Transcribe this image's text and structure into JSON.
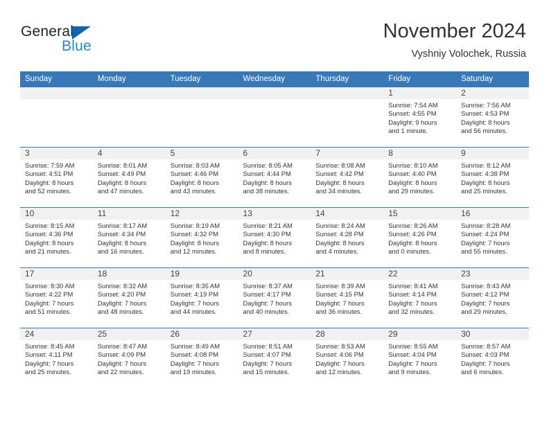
{
  "brand": {
    "name_part1": "General",
    "name_part2": "Blue",
    "accent_color": "#1f86d6",
    "triangle_color": "#1066ad"
  },
  "header": {
    "title": "November 2024",
    "subtitle": "Vyshniy Volochek, Russia"
  },
  "calendar": {
    "header_bg": "#3878b9",
    "daynum_bg": "#f1f1f1",
    "weekdays": [
      "Sunday",
      "Monday",
      "Tuesday",
      "Wednesday",
      "Thursday",
      "Friday",
      "Saturday"
    ],
    "weeks": [
      [
        {
          "day": "",
          "sunrise": "",
          "sunset": "",
          "daylight_line1": "",
          "daylight_line2": ""
        },
        {
          "day": "",
          "sunrise": "",
          "sunset": "",
          "daylight_line1": "",
          "daylight_line2": ""
        },
        {
          "day": "",
          "sunrise": "",
          "sunset": "",
          "daylight_line1": "",
          "daylight_line2": ""
        },
        {
          "day": "",
          "sunrise": "",
          "sunset": "",
          "daylight_line1": "",
          "daylight_line2": ""
        },
        {
          "day": "",
          "sunrise": "",
          "sunset": "",
          "daylight_line1": "",
          "daylight_line2": ""
        },
        {
          "day": "1",
          "sunrise": "Sunrise: 7:54 AM",
          "sunset": "Sunset: 4:55 PM",
          "daylight_line1": "Daylight: 9 hours",
          "daylight_line2": "and 1 minute."
        },
        {
          "day": "2",
          "sunrise": "Sunrise: 7:56 AM",
          "sunset": "Sunset: 4:53 PM",
          "daylight_line1": "Daylight: 8 hours",
          "daylight_line2": "and 56 minutes."
        }
      ],
      [
        {
          "day": "3",
          "sunrise": "Sunrise: 7:59 AM",
          "sunset": "Sunset: 4:51 PM",
          "daylight_line1": "Daylight: 8 hours",
          "daylight_line2": "and 52 minutes."
        },
        {
          "day": "4",
          "sunrise": "Sunrise: 8:01 AM",
          "sunset": "Sunset: 4:49 PM",
          "daylight_line1": "Daylight: 8 hours",
          "daylight_line2": "and 47 minutes."
        },
        {
          "day": "5",
          "sunrise": "Sunrise: 8:03 AM",
          "sunset": "Sunset: 4:46 PM",
          "daylight_line1": "Daylight: 8 hours",
          "daylight_line2": "and 43 minutes."
        },
        {
          "day": "6",
          "sunrise": "Sunrise: 8:05 AM",
          "sunset": "Sunset: 4:44 PM",
          "daylight_line1": "Daylight: 8 hours",
          "daylight_line2": "and 38 minutes."
        },
        {
          "day": "7",
          "sunrise": "Sunrise: 8:08 AM",
          "sunset": "Sunset: 4:42 PM",
          "daylight_line1": "Daylight: 8 hours",
          "daylight_line2": "and 34 minutes."
        },
        {
          "day": "8",
          "sunrise": "Sunrise: 8:10 AM",
          "sunset": "Sunset: 4:40 PM",
          "daylight_line1": "Daylight: 8 hours",
          "daylight_line2": "and 29 minutes."
        },
        {
          "day": "9",
          "sunrise": "Sunrise: 8:12 AM",
          "sunset": "Sunset: 4:38 PM",
          "daylight_line1": "Daylight: 8 hours",
          "daylight_line2": "and 25 minutes."
        }
      ],
      [
        {
          "day": "10",
          "sunrise": "Sunrise: 8:15 AM",
          "sunset": "Sunset: 4:36 PM",
          "daylight_line1": "Daylight: 8 hours",
          "daylight_line2": "and 21 minutes."
        },
        {
          "day": "11",
          "sunrise": "Sunrise: 8:17 AM",
          "sunset": "Sunset: 4:34 PM",
          "daylight_line1": "Daylight: 8 hours",
          "daylight_line2": "and 16 minutes."
        },
        {
          "day": "12",
          "sunrise": "Sunrise: 8:19 AM",
          "sunset": "Sunset: 4:32 PM",
          "daylight_line1": "Daylight: 8 hours",
          "daylight_line2": "and 12 minutes."
        },
        {
          "day": "13",
          "sunrise": "Sunrise: 8:21 AM",
          "sunset": "Sunset: 4:30 PM",
          "daylight_line1": "Daylight: 8 hours",
          "daylight_line2": "and 8 minutes."
        },
        {
          "day": "14",
          "sunrise": "Sunrise: 8:24 AM",
          "sunset": "Sunset: 4:28 PM",
          "daylight_line1": "Daylight: 8 hours",
          "daylight_line2": "and 4 minutes."
        },
        {
          "day": "15",
          "sunrise": "Sunrise: 8:26 AM",
          "sunset": "Sunset: 4:26 PM",
          "daylight_line1": "Daylight: 8 hours",
          "daylight_line2": "and 0 minutes."
        },
        {
          "day": "16",
          "sunrise": "Sunrise: 8:28 AM",
          "sunset": "Sunset: 4:24 PM",
          "daylight_line1": "Daylight: 7 hours",
          "daylight_line2": "and 55 minutes."
        }
      ],
      [
        {
          "day": "17",
          "sunrise": "Sunrise: 8:30 AM",
          "sunset": "Sunset: 4:22 PM",
          "daylight_line1": "Daylight: 7 hours",
          "daylight_line2": "and 51 minutes."
        },
        {
          "day": "18",
          "sunrise": "Sunrise: 8:32 AM",
          "sunset": "Sunset: 4:20 PM",
          "daylight_line1": "Daylight: 7 hours",
          "daylight_line2": "and 48 minutes."
        },
        {
          "day": "19",
          "sunrise": "Sunrise: 8:35 AM",
          "sunset": "Sunset: 4:19 PM",
          "daylight_line1": "Daylight: 7 hours",
          "daylight_line2": "and 44 minutes."
        },
        {
          "day": "20",
          "sunrise": "Sunrise: 8:37 AM",
          "sunset": "Sunset: 4:17 PM",
          "daylight_line1": "Daylight: 7 hours",
          "daylight_line2": "and 40 minutes."
        },
        {
          "day": "21",
          "sunrise": "Sunrise: 8:39 AM",
          "sunset": "Sunset: 4:15 PM",
          "daylight_line1": "Daylight: 7 hours",
          "daylight_line2": "and 36 minutes."
        },
        {
          "day": "22",
          "sunrise": "Sunrise: 8:41 AM",
          "sunset": "Sunset: 4:14 PM",
          "daylight_line1": "Daylight: 7 hours",
          "daylight_line2": "and 32 minutes."
        },
        {
          "day": "23",
          "sunrise": "Sunrise: 8:43 AM",
          "sunset": "Sunset: 4:12 PM",
          "daylight_line1": "Daylight: 7 hours",
          "daylight_line2": "and 29 minutes."
        }
      ],
      [
        {
          "day": "24",
          "sunrise": "Sunrise: 8:45 AM",
          "sunset": "Sunset: 4:11 PM",
          "daylight_line1": "Daylight: 7 hours",
          "daylight_line2": "and 25 minutes."
        },
        {
          "day": "25",
          "sunrise": "Sunrise: 8:47 AM",
          "sunset": "Sunset: 4:09 PM",
          "daylight_line1": "Daylight: 7 hours",
          "daylight_line2": "and 22 minutes."
        },
        {
          "day": "26",
          "sunrise": "Sunrise: 8:49 AM",
          "sunset": "Sunset: 4:08 PM",
          "daylight_line1": "Daylight: 7 hours",
          "daylight_line2": "and 19 minutes."
        },
        {
          "day": "27",
          "sunrise": "Sunrise: 8:51 AM",
          "sunset": "Sunset: 4:07 PM",
          "daylight_line1": "Daylight: 7 hours",
          "daylight_line2": "and 15 minutes."
        },
        {
          "day": "28",
          "sunrise": "Sunrise: 8:53 AM",
          "sunset": "Sunset: 4:06 PM",
          "daylight_line1": "Daylight: 7 hours",
          "daylight_line2": "and 12 minutes."
        },
        {
          "day": "29",
          "sunrise": "Sunrise: 8:55 AM",
          "sunset": "Sunset: 4:04 PM",
          "daylight_line1": "Daylight: 7 hours",
          "daylight_line2": "and 9 minutes."
        },
        {
          "day": "30",
          "sunrise": "Sunrise: 8:57 AM",
          "sunset": "Sunset: 4:03 PM",
          "daylight_line1": "Daylight: 7 hours",
          "daylight_line2": "and 6 minutes."
        }
      ]
    ]
  }
}
